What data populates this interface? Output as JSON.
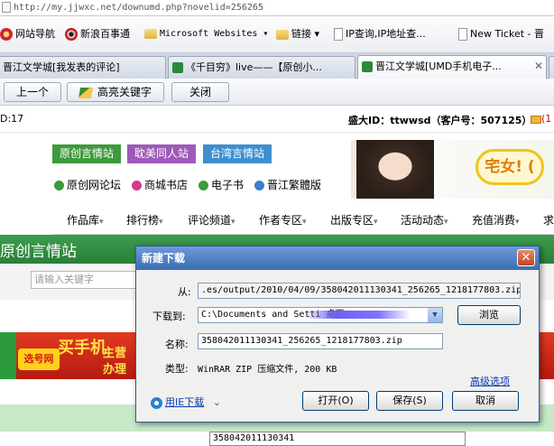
{
  "browser": {
    "address": "http://my.jjwxc.net/downumd.php?novelid=256265",
    "favorites": [
      {
        "label": "网站导航",
        "icon": "red-logo-icon"
      },
      {
        "label": "新浪百事通",
        "icon": "sina-eye-icon"
      },
      {
        "label": "Microsoft Websites",
        "icon": "folder-icon",
        "dropdown": true
      },
      {
        "label": "链接",
        "icon": "folder-icon",
        "dropdown": true
      },
      {
        "label": "IP查询,IP地址查...",
        "icon": "page-icon"
      },
      {
        "label": "New Ticket - 晋",
        "icon": "page-icon"
      }
    ],
    "tabs": [
      {
        "label": "晋江文学城[我发表的评论]"
      },
      {
        "label": "《千目穷》live——【原创小..."
      },
      {
        "label": "晋江文学城[UMD手机电子...",
        "active": true
      }
    ],
    "toolbar": {
      "prev": "上一个",
      "highlight": "高亮关键字",
      "close": "关闭"
    }
  },
  "page": {
    "left_fragment": "D:17",
    "user_info": "盛大ID：ttwwsd（客户号：507125）",
    "user_info_tail": "(1",
    "site_buttons": [
      {
        "label": "原创言情站",
        "color": "#3e9a3b"
      },
      {
        "label": "耽美同人站",
        "color": "#9d5ab8"
      },
      {
        "label": "台湾言情站",
        "color": "#3e8fd0"
      }
    ],
    "site_links": [
      {
        "label": "原创网论坛",
        "dot": "#3a9b3a"
      },
      {
        "label": "商城书店",
        "dot": "#d23a8b"
      },
      {
        "label": "电子书",
        "dot": "#3a9b3a"
      },
      {
        "label": "晋江繁體版",
        "dot": "#3f7fcc"
      }
    ],
    "banner_text": "宅女! (",
    "nav": [
      "作品库",
      "排行榜",
      "评论频道",
      "作者专区",
      "出版专区",
      "活动动态",
      "充值消费",
      "求"
    ],
    "green_title": "原创言情站",
    "search_placeholder": "请输入关键字",
    "ad_title": "买手机",
    "ad_sub1": "主营",
    "ad_sub2": "办理",
    "ad_logo": "选号网",
    "bottom_field": "358042011130341"
  },
  "dialog": {
    "title": "新建下载",
    "from_label": "从:",
    "from_value": ".es/output/2010/04/09/358042011130341_256265_1218177803.zip",
    "save_to_label": "下载到:",
    "save_to_value": "C:\\Documents and Setti         桌面\\",
    "browse_label": "浏览",
    "name_label": "名称:",
    "name_value": "358042011130341_256265_1218177803.zip",
    "type_label": "类型:",
    "type_value": "WinRAR ZIP 压缩文件, 200 KB",
    "advanced_label": "高级选项",
    "ie_download_label": "用IE下载",
    "open_label": "打开(O)",
    "save_label": "保存(S)",
    "cancel_label": "取消"
  }
}
